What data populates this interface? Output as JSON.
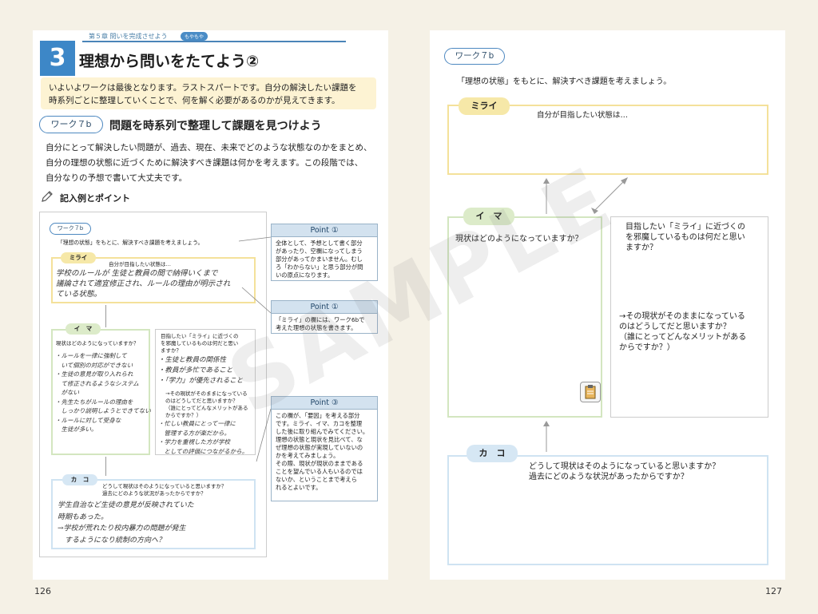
{
  "left": {
    "chapter": "第５章 問いを完成させよう",
    "chapter_tag": "もやもや",
    "section_number": "3",
    "section_title": "理想から問いをたてよう②",
    "intro_lines": [
      "いよいよワークは最後となります。ラストスパートです。自分の解決したい課題を",
      "時系列ごとに整理していくことで、何を解く必要があるのかが見えてきます。"
    ],
    "work_label": "ワーク７b",
    "work_title": "問題を時系列で整理して課題を見つけよう",
    "body_lines": [
      "自分にとって解決したい問題が、過去、現在、未来でどのような状態なのかをまとめ、",
      "自分の理想の状態に近づくために解決すべき課題は何かを考えます。この段階では、",
      "自分なりの予想で書いて大丈夫です。"
    ],
    "example_title": "記入例とポイント",
    "sample": {
      "work_label": "ワーク７b",
      "instruction": "「理想の状態」をもとに、解決すべき課題を考えましょう。",
      "mirai_label": "ミライ",
      "mirai_prompt": "自分が目指したい状態は…",
      "mirai_hand": [
        "学校のルールが 生徒と教員の間で納得いくまで",
        "議論されて適宜修正され、ルールの理由が明示され",
        "ている状態。"
      ],
      "ima_label": "イ　マ",
      "ima_prompt": "現状はどのようになっていますか？",
      "ima_hand": [
        "・ルールを一律に強制して",
        "　いて個別の対応ができない",
        "・生徒の意見が取り入れられ",
        "　て修正されるようなシステム",
        "　がない",
        "・先生たちがルールの理由を",
        "　しっかり説明しようとできてない",
        "・ルールに対して受身な",
        "　生徒が多い。"
      ],
      "jama_prompt": [
        "目指したい「ミライ」に近づくの",
        "を邪魔しているものは何だと思い",
        "ますか？"
      ],
      "jama_hand": [
        "・生徒と教員の関係性",
        "・教員が多忙であること",
        "・「学力」が優先されること"
      ],
      "why_prompt": [
        "→その現状がそのままになっている",
        "のはどうしてだと思いますか？",
        "（誰にとってどんなメリットがある",
        "からですか？）"
      ],
      "why_hand": [
        "・忙しい教員にとって一律に",
        "　管理する方が楽だから。",
        "・学力を重視した方が学校",
        "　としての評価につながるから。"
      ],
      "kako_label": "カ　コ",
      "kako_prompt": [
        "どうして現状はそのようになっていると思いますか？",
        "過去にどのような状況があったからですか？"
      ],
      "kako_hand": [
        "学生自治など生徒の意見が反映されていた",
        "時期もあった。",
        "→学校が荒れたり校内暴力の問題が発生",
        "　するようになり統制の方向へ？"
      ]
    },
    "points": [
      {
        "title": "Point ①",
        "lines": [
          "全体として、予想として書く部分",
          "があったり、空欄になってしまう",
          "部分があってかまいません。むし",
          "ろ「わからない」と思う部分が問",
          "いの原点になります。"
        ]
      },
      {
        "title": "Point ①",
        "lines": [
          "「ミライ」の欄には、ワーク6bで",
          "考えた理想の状態を書きます。"
        ]
      },
      {
        "title": "Point ③",
        "lines": [
          "この欄が、「要因」を考える部分",
          "です。ミライ、イマ、カコを整理",
          "した後に取り組んでみてください。",
          "理想の状態と現状を見比べて、な",
          "ぜ理想の状態が実現していないの",
          "かを考えてみましょう。",
          "その際、現状が現状のままである",
          "ことを望んでいる人もいるのでは",
          "ないか、ということまで考えら",
          "れるとよいです。"
        ]
      }
    ],
    "page_number": "126"
  },
  "right": {
    "work_label": "ワーク７b",
    "instruction": "「理想の状態」をもとに、解決すべき課題を考えましょう。",
    "mirai_label": "ミライ",
    "mirai_prompt": "自分が目指したい状態は…",
    "ima_label": "イ　マ",
    "ima_prompt": "現状はどのようになっていますか？",
    "jama_prompt": [
      "目指したい「ミライ」に近づくの",
      "を邪魔しているものは何だと思い",
      "ますか？"
    ],
    "why_prompt": [
      "→その現状がそのままになっている",
      "のはどうしてだと思いますか？",
      "（誰にとってどんなメリットがある",
      "からですか？）"
    ],
    "kako_label": "カ　コ",
    "kako_prompt": [
      "どうして現状はそのようになっていると思いますか？",
      "過去にどのような状況があったからですか？"
    ],
    "page_number": "127"
  },
  "watermark": "SAMPLE",
  "icons": {
    "pencil": "pencil-icon",
    "clipboard": "clipboard-icon"
  },
  "colors": {
    "accent_blue": "#3d87c7",
    "mirai_yellow": "#f4e19a",
    "ima_green": "#d3e6c0",
    "kako_blue": "#cfe3f2"
  }
}
